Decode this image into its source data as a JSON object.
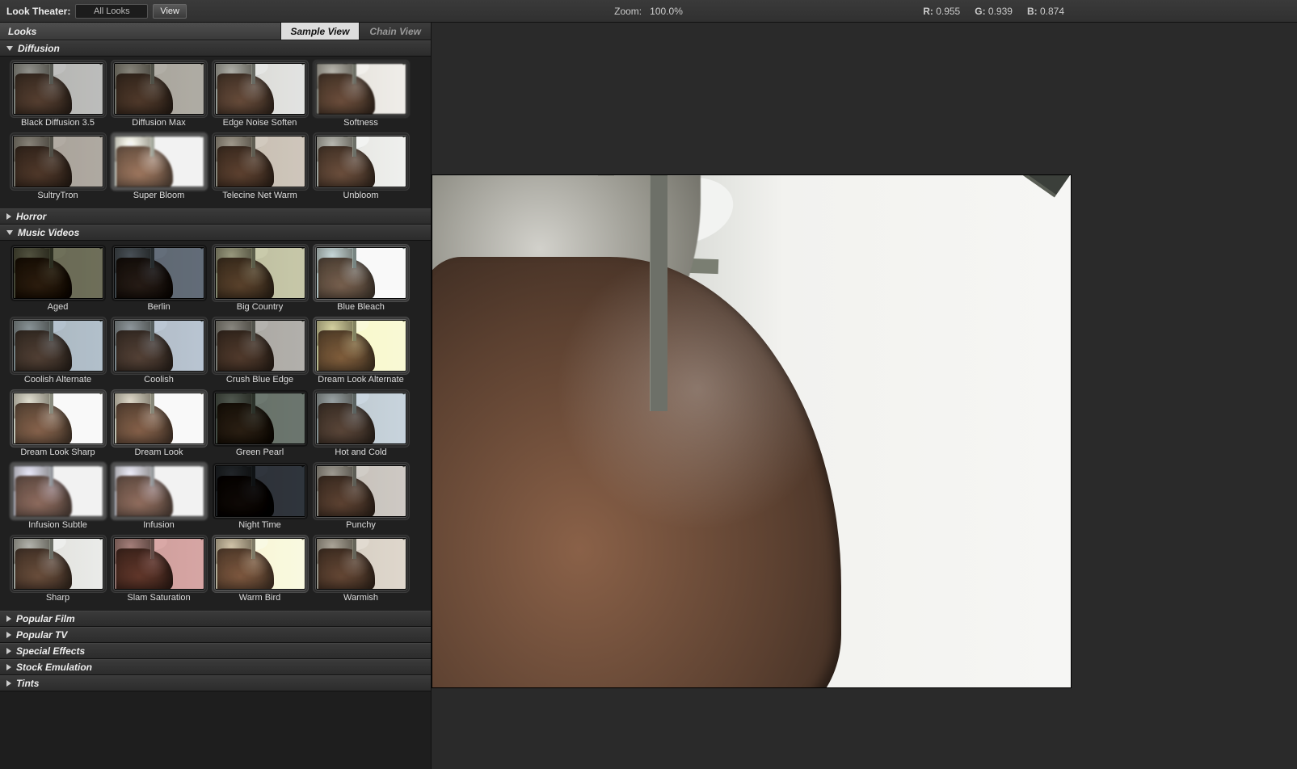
{
  "topbar": {
    "label": "Look Theater:",
    "dropdown_value": "All Looks",
    "view_btn": "View",
    "zoom_label": "Zoom:",
    "zoom_value": "100.0%",
    "r_label": "R:",
    "r_value": "0.955",
    "g_label": "G:",
    "g_value": "0.939",
    "b_label": "B:",
    "b_value": "0.874"
  },
  "panel": {
    "title": "Looks",
    "tab_sample": "Sample View",
    "tab_chain": "Chain View"
  },
  "categories": [
    {
      "name": "Diffusion",
      "expanded": true,
      "items": [
        {
          "label": "Black Diffusion 3.5",
          "tint": "rgba(40,40,40,0.25)",
          "extra": ""
        },
        {
          "label": "Diffusion Max",
          "tint": "rgba(60,50,30,0.35)",
          "extra": ""
        },
        {
          "label": "Edge Noise Soften",
          "tint": "rgba(0,0,0,0.05)",
          "extra": ""
        },
        {
          "label": "Softness",
          "tint": "rgba(255,240,230,0.18)",
          "extra": "blur"
        },
        {
          "label": "SultryTron",
          "tint": "rgba(60,40,20,0.35)",
          "extra": ""
        },
        {
          "label": "Super Bloom",
          "tint": "rgba(255,255,255,0.55)",
          "extra": "bloom"
        },
        {
          "label": "Telecine Net Warm",
          "tint": "rgba(120,80,40,0.25)",
          "extra": ""
        },
        {
          "label": "Unbloom",
          "tint": "rgba(0,0,0,0.0)",
          "extra": ""
        }
      ]
    },
    {
      "name": "Horror",
      "expanded": false,
      "items": []
    },
    {
      "name": "Music Videos",
      "expanded": true,
      "items": [
        {
          "label": "Aged",
          "tint": "rgba(100,100,50,0.55)",
          "extra": "dark"
        },
        {
          "label": "Berlin",
          "tint": "rgba(30,60,100,0.45)",
          "extra": "dark"
        },
        {
          "label": "Big Country",
          "tint": "rgba(160,160,90,0.45)",
          "extra": ""
        },
        {
          "label": "Blue Bleach",
          "tint": "rgba(200,235,255,0.55)",
          "extra": "bright"
        },
        {
          "label": "Coolish Alternate",
          "tint": "rgba(70,110,150,0.35)",
          "extra": ""
        },
        {
          "label": "Coolish",
          "tint": "rgba(110,140,180,0.40)",
          "extra": ""
        },
        {
          "label": "Crush Blue Edge",
          "tint": "rgba(40,30,20,0.30)",
          "extra": ""
        },
        {
          "label": "Dream Look Alternate",
          "tint": "rgba(230,220,120,0.50)",
          "extra": "bright"
        },
        {
          "label": "Dream Look Sharp",
          "tint": "rgba(255,245,225,0.35)",
          "extra": "bright"
        },
        {
          "label": "Dream Look",
          "tint": "rgba(245,225,200,0.35)",
          "extra": "bright"
        },
        {
          "label": "Green Pearl",
          "tint": "rgba(60,90,70,0.45)",
          "extra": "dark"
        },
        {
          "label": "Hot and Cold",
          "tint": "rgba(150,180,210,0.40)",
          "extra": ""
        },
        {
          "label": "Infusion Subtle",
          "tint": "rgba(200,200,255,0.50)",
          "extra": "bloom"
        },
        {
          "label": "Infusion",
          "tint": "rgba(220,220,255,0.65)",
          "extra": "bloom"
        },
        {
          "label": "Night Time",
          "tint": "rgba(10,20,35,0.70)",
          "extra": "dark"
        },
        {
          "label": "Punchy",
          "tint": "rgba(80,50,30,0.20)",
          "extra": ""
        },
        {
          "label": "Sharp",
          "tint": "rgba(0,0,0,0.02)",
          "extra": ""
        },
        {
          "label": "Slam Saturation",
          "tint": "rgba(180,30,30,0.35)",
          "extra": ""
        },
        {
          "label": "Warm Bird",
          "tint": "rgba(210,170,110,0.40)",
          "extra": "bright"
        },
        {
          "label": "Warmish",
          "tint": "rgba(200,170,140,0.30)",
          "extra": ""
        }
      ]
    },
    {
      "name": "Popular Film",
      "expanded": false,
      "items": []
    },
    {
      "name": "Popular TV",
      "expanded": false,
      "items": []
    },
    {
      "name": "Special Effects",
      "expanded": false,
      "items": []
    },
    {
      "name": "Stock Emulation",
      "expanded": false,
      "items": []
    },
    {
      "name": "Tints",
      "expanded": false,
      "items": []
    }
  ]
}
